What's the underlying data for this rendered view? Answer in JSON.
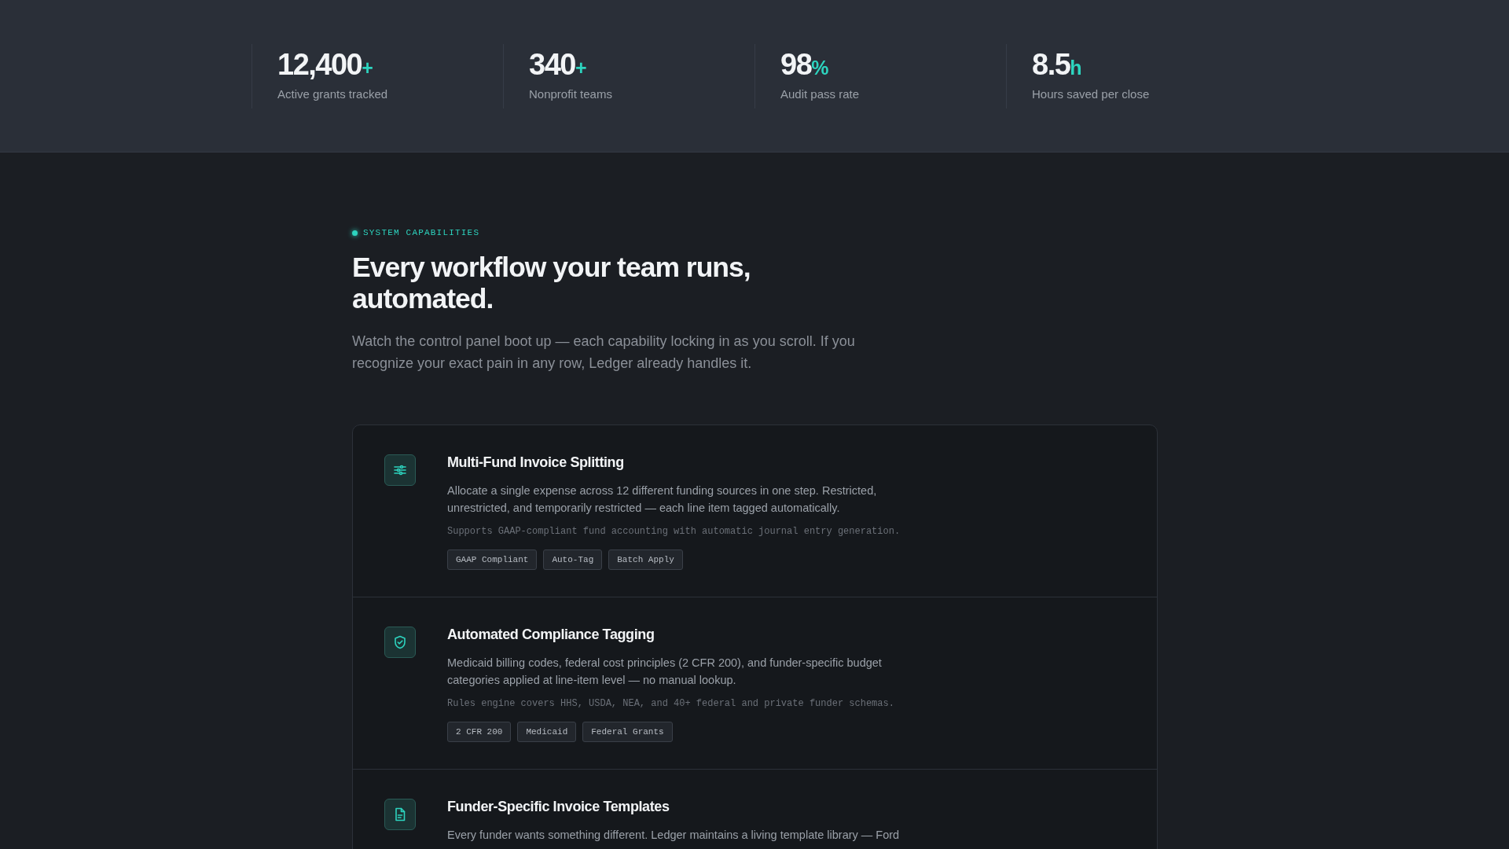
{
  "stats": [
    {
      "value": "12,400",
      "suffix": "+",
      "label": "Active grants tracked"
    },
    {
      "value": "340",
      "suffix": "+",
      "label": "Nonprofit teams"
    },
    {
      "value": "98",
      "suffix": "%",
      "label": "Audit pass rate"
    },
    {
      "value": "8.5",
      "suffix": "h",
      "label": "Hours saved per close"
    }
  ],
  "section": {
    "eyebrow": "SYSTEM CAPABILITIES",
    "heading": "Every workflow your team runs, automated.",
    "intro": "Watch the control panel boot up — each capability locking in as you scroll. If you recognize your exact pain in any row, Ledger already handles it."
  },
  "capabilities": [
    {
      "kind": "sliders",
      "title": "Multi-Fund Invoice Splitting",
      "description": "Allocate a single expense across 12 different funding sources in one step. Restricted, unrestricted, and temporarily restricted — each line item tagged automatically.",
      "note": "Supports GAAP-compliant fund accounting with automatic journal entry generation.",
      "tags": [
        "GAAP Compliant",
        "Auto-Tag",
        "Batch Apply"
      ]
    },
    {
      "kind": "shield",
      "title": "Automated Compliance Tagging",
      "description": "Medicaid billing codes, federal cost principles (2 CFR 200), and funder-specific budget categories applied at line-item level — no manual lookup.",
      "note": "Rules engine covers HHS, USDA, NEA, and 40+ federal and private funder schemas.",
      "tags": [
        "2 CFR 200",
        "Medicaid",
        "Federal Grants"
      ]
    },
    {
      "kind": "document",
      "title": "Funder-Specific Invoice Templates",
      "description": "Every funder wants something different. Ledger maintains a living template library — Ford"
    }
  ]
}
